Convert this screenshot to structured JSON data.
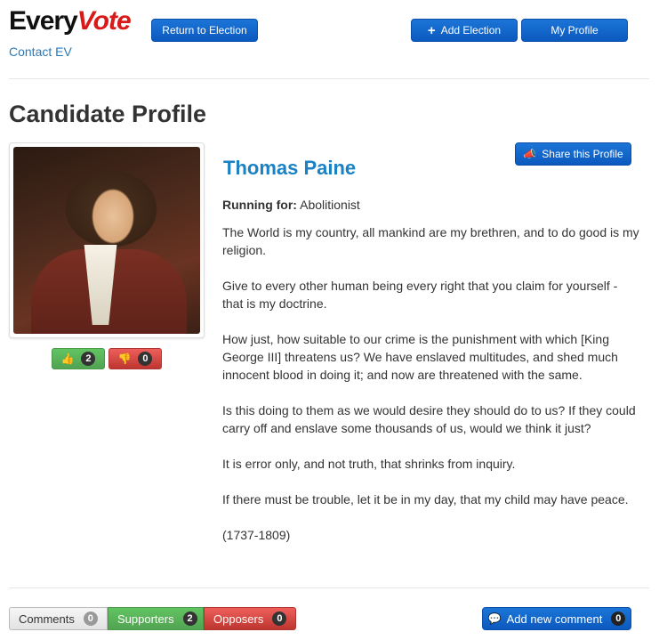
{
  "brand": {
    "name_part1": "Every",
    "name_part2": "Vote",
    "contact": "Contact EV"
  },
  "nav": {
    "return_label": "Return to Election",
    "add_election_label": "Add Election",
    "my_profile_label": "My Profile"
  },
  "page": {
    "title": "Candidate Profile"
  },
  "candidate": {
    "name": "Thomas Paine",
    "running_label": "Running for:",
    "running_value": "Abolitionist",
    "share_label": "Share this Profile",
    "votes_up": "2",
    "votes_down": "0",
    "bio": [
      "The World is my country, all mankind are my brethren, and to do good is my religion.",
      "Give to every other human being every right that you claim for yourself - that is my doctrine.",
      "How just, how suitable to our crime is the punishment with which [King George III] threatens us? We have enslaved multitudes, and shed much innocent blood in doing it; and now are threatened with the same.",
      "Is this doing to them as we would desire they should do to us? If they could carry off and enslave some thousands of us, would we think it just?",
      "It is error only, and not truth, that shrinks from inquiry.",
      "If there must be trouble, let it be in my day, that my child may have peace.",
      "(1737-1809)"
    ]
  },
  "tabs": {
    "comments_label": "Comments",
    "comments_count": "0",
    "supporters_label": "Supporters",
    "supporters_count": "2",
    "opposers_label": "Opposers",
    "opposers_count": "0"
  },
  "comment": {
    "add_label": "Add new comment",
    "count": "0"
  },
  "colors": {
    "brand_red": "#d91a1a",
    "link_blue": "#1a82c4",
    "button_blue": "#0b59c0",
    "success": "#51a351",
    "danger": "#bd362f"
  },
  "icons": [
    "plus-icon",
    "megaphone-icon",
    "thumbs-up-icon",
    "thumbs-down-icon",
    "comment-icon"
  ]
}
